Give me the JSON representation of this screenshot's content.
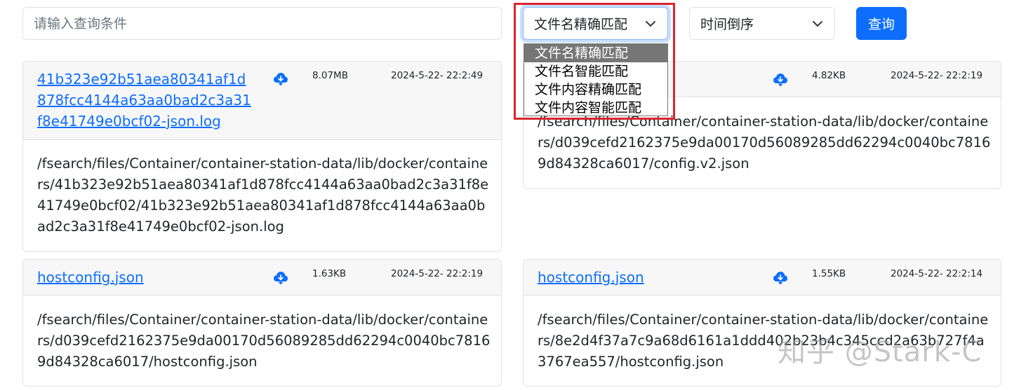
{
  "search": {
    "placeholder": "请输入查询条件",
    "value": ""
  },
  "match_select": {
    "value": "文件名精确匹配",
    "options": [
      "文件名精确匹配",
      "文件名智能匹配",
      "文件内容精确匹配",
      "文件内容智能匹配"
    ],
    "expanded": true,
    "highlighted_index": 0
  },
  "sort_select": {
    "value": "时间倒序"
  },
  "query_button": {
    "label": "查询"
  },
  "colors": {
    "accent": "#0d6efd",
    "highlight_border": "#d8262f"
  },
  "results": [
    {
      "name": "41b323e92b51aea80341af1d878fcc4144a63aa0bad2c3a31f8e41749e0bcf02-json.log",
      "size": "8.07MB",
      "date": "2024-5-22- 22:2:49",
      "path": "/fsearch/files/Container/container-station-data/lib/docker/containers/41b323e92b51aea80341af1d878fcc4144a63aa0bad2c3a31f8e41749e0bcf02/41b323e92b51aea80341af1d878fcc4144a63aa0bad2c3a31f8e41749e0bcf02-json.log",
      "icon": "cloud-download-icon"
    },
    {
      "name": "",
      "size": "4.82KB",
      "date": "2024-5-22- 22:2:19",
      "path": "/fsearch/files/Container/container-station-data/lib/docker/containers/d039cefd2162375e9da00170d56089285dd62294c0040bc78169d84328ca6017/config.v2.json",
      "icon": "cloud-download-icon"
    },
    {
      "name": "hostconfig.json",
      "size": "1.63KB",
      "date": "2024-5-22- 22:2:19",
      "path": "/fsearch/files/Container/container-station-data/lib/docker/containers/d039cefd2162375e9da00170d56089285dd62294c0040bc78169d84328ca6017/hostconfig.json",
      "icon": "cloud-download-icon"
    },
    {
      "name": "hostconfig.json",
      "size": "1.55KB",
      "date": "2024-5-22- 22:2:14",
      "path": "/fsearch/files/Container/container-station-data/lib/docker/containers/8e2d4f37a7c9a68d6161a1ddd402b23b4c345ccd2a63b727f4a3767ea557/hostconfig.json",
      "icon": "cloud-download-icon"
    }
  ],
  "watermark": "知乎 @Stark-C"
}
